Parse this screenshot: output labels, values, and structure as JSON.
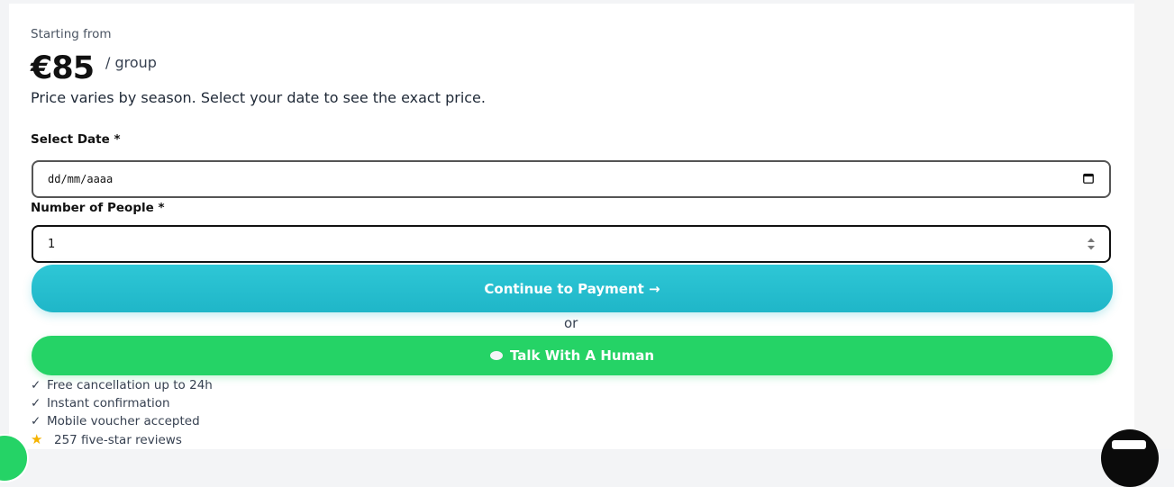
{
  "pricing": {
    "starting_label": "Starting from",
    "price": "€85",
    "unit": "/ group",
    "note": "Price varies by season. Select your date to see the exact price."
  },
  "form": {
    "date_label": "Select Date *",
    "date_placeholder": "dd/mm/aaaa",
    "people_label": "Number of People *",
    "people_value": "1"
  },
  "actions": {
    "pay_label": "Continue to Payment →",
    "or_label": "or",
    "human_label": "Talk With A Human"
  },
  "features": [
    "Free cancellation up to 24h",
    "Instant confirmation",
    "Mobile voucher accepted"
  ],
  "reviews": "257 five-star reviews",
  "colors": {
    "pay_button": "#22bfd0",
    "human_button": "#25d366",
    "star": "#f5b301"
  }
}
